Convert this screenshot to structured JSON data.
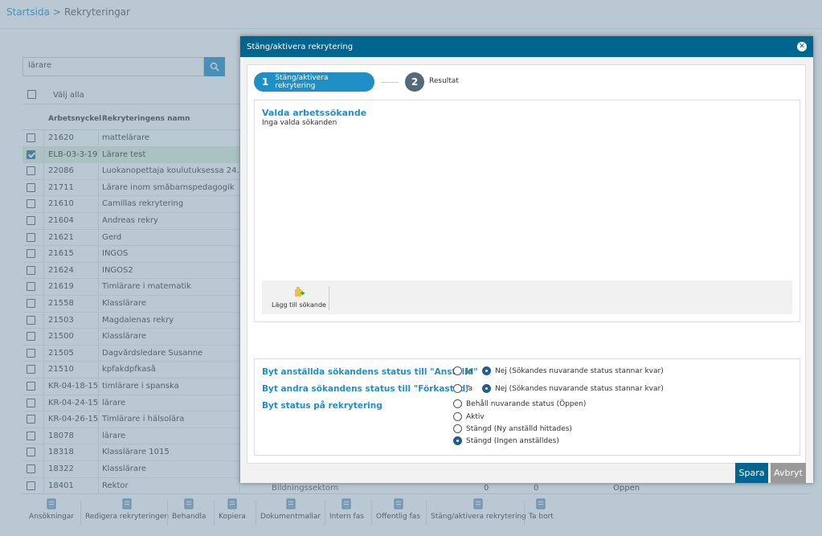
{
  "breadcrumb": {
    "home": "Startsida",
    "separator": ">",
    "current": "Rekryteringar"
  },
  "search": {
    "value": "lärare"
  },
  "table": {
    "select_all": "Välj alla",
    "col_key": "Arbetsnyckel",
    "col_name": "Rekryteringens namn",
    "rows": [
      {
        "key": "21620",
        "name": "mattelärare",
        "checked": false
      },
      {
        "key": "ELB-03-3-19",
        "name": "Lärare test",
        "checked": true
      },
      {
        "key": "22086",
        "name": "Luokanopettaja koulutuksessa 24.1.19",
        "checked": false
      },
      {
        "key": "21711",
        "name": "Lärare inom småbarnspedagogik",
        "checked": false
      },
      {
        "key": "21610",
        "name": "Camillas rekrytering",
        "checked": false
      },
      {
        "key": "21604",
        "name": "Andreas rekry",
        "checked": false
      },
      {
        "key": "21621",
        "name": "Gerd",
        "checked": false
      },
      {
        "key": "21615",
        "name": "INGOS",
        "checked": false
      },
      {
        "key": "21624",
        "name": "INGOS2",
        "checked": false
      },
      {
        "key": "21619",
        "name": "Timlärare i matematik",
        "checked": false
      },
      {
        "key": "21558",
        "name": "Klasslärare",
        "checked": false
      },
      {
        "key": "21503",
        "name": "Magdalenas rekry",
        "checked": false
      },
      {
        "key": "21500",
        "name": "Klasslärare",
        "checked": false
      },
      {
        "key": "21505",
        "name": "Dagvårdsledare Susanne",
        "checked": false
      },
      {
        "key": "21510",
        "name": "kpfakdpfkaså",
        "checked": false
      },
      {
        "key": "KR-04-18-15",
        "name": "timlärare i spanska",
        "checked": false
      },
      {
        "key": "KR-04-24-15",
        "name": "lärare",
        "checked": false
      },
      {
        "key": "KR-04-26-15",
        "name": "Timlärare i hälsolära",
        "checked": false
      },
      {
        "key": "18078",
        "name": "lärare",
        "checked": false
      },
      {
        "key": "18318",
        "name": "Klasslärare 1015",
        "checked": false
      },
      {
        "key": "18322",
        "name": "Klasslärare",
        "checked": false
      },
      {
        "key": "18401",
        "name": "Rektor",
        "checked": false
      }
    ],
    "last_row_extra": {
      "dept": "Bildningssektorn",
      "v1": "0",
      "v2": "0",
      "status": "Öppen"
    }
  },
  "toolbar": {
    "items": [
      "Ansökningar",
      "Redigera rekryteringen",
      "Behandla",
      "Kopiera",
      "Dokumentmallar",
      "Intern fas",
      "Offentlig fas",
      "Stäng/aktivera rekrytering",
      "Ta bort"
    ]
  },
  "modal": {
    "title": "Stäng/aktivera rekrytering",
    "close_symbol": "✕",
    "step1_num": "1",
    "step1_label": "Stäng/aktivera rekrytering",
    "step2_num": "2",
    "step2_label": "Resultat",
    "selected_title": "Valda arbetssökande",
    "selected_empty": "Inga valda sökanden",
    "add_applicant": "Lägg till sökande",
    "opt1_label": "Byt anställda sökandens status till \"Anställd\"",
    "opt2_label": "Byt andra sökandens status till \"Förkastad\"",
    "opt3_label": "Byt status på rekrytering",
    "yes": "Ja",
    "no_keep": "Nej (Sökandes nuvarande status stannar kvar)",
    "status_options": [
      "Behåll nuvarande status (Öppen)",
      "Aktiv",
      "Stängd (Ny anställd hittades)",
      "Stängd (Ingen anställdes)"
    ],
    "status_selected": 3,
    "save": "Spara",
    "cancel": "Avbryt"
  },
  "colors": {
    "accent": "#1f8fc6",
    "header": "#00668f",
    "stepper": "#536a7a"
  }
}
